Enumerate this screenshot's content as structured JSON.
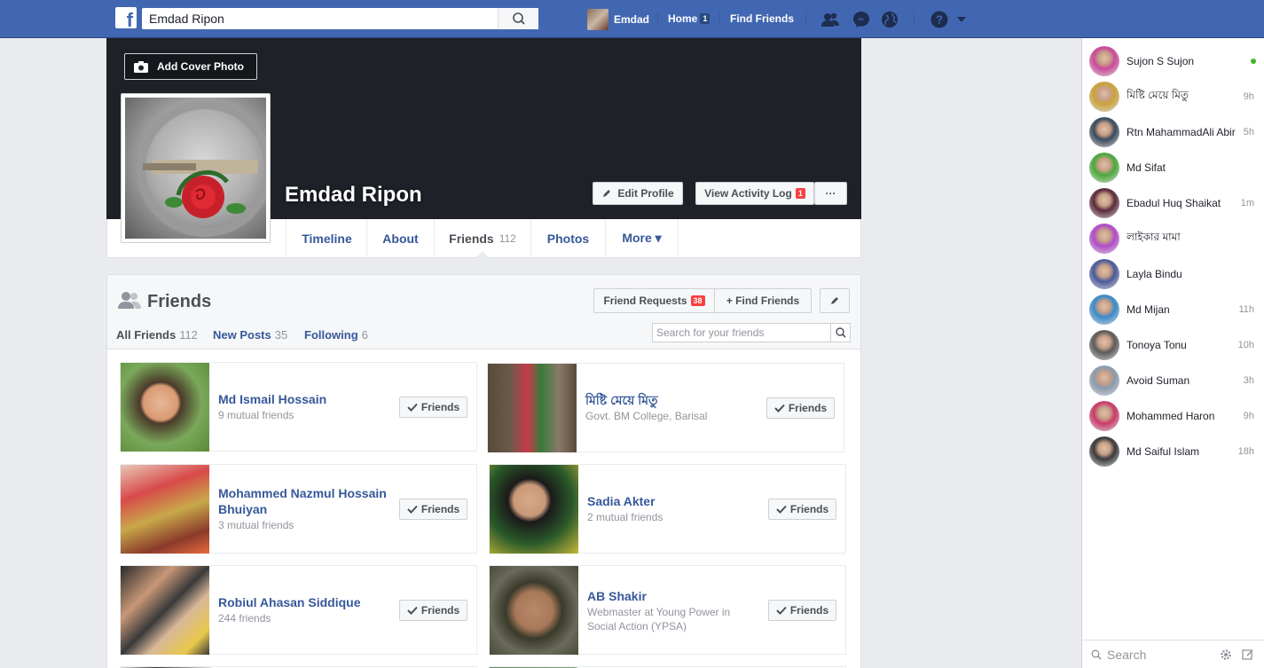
{
  "topbar": {
    "logo": "f",
    "search_value": "Emdad Ripon",
    "user_name": "Emdad",
    "home_label": "Home",
    "home_badge": "1",
    "find_friends_label": "Find Friends"
  },
  "cover": {
    "add_cover_label": "Add Cover Photo",
    "profile_name": "Emdad Ripon",
    "edit_profile_label": "Edit Profile",
    "activity_log_label": "View Activity Log",
    "activity_log_badge": "1",
    "more_label": "···"
  },
  "tabs": [
    {
      "label": "Timeline"
    },
    {
      "label": "About"
    },
    {
      "label": "Friends",
      "count": "112"
    },
    {
      "label": "Photos"
    },
    {
      "label": "More ▾"
    }
  ],
  "friends_panel": {
    "title": "Friends",
    "requests_label": "Friend Requests",
    "requests_badge": "38",
    "find_friends_label": "+ Find Friends",
    "subtabs": [
      {
        "label": "All Friends",
        "count": "112"
      },
      {
        "label": "New Posts",
        "count": "35"
      },
      {
        "label": "Following",
        "count": "6"
      }
    ],
    "search_placeholder": "Search for your friends",
    "button_label": "Friends",
    "friends": [
      {
        "name": "Md Ismail Hossain",
        "sub": "9 mutual friends",
        "photo": "#6b8f3a"
      },
      {
        "name": "মিষ্টি মেয়ে মিতু",
        "sub": "Govt. BM College, Barisal",
        "photo": "#9a3b3b"
      },
      {
        "name": "Mohammed Nazmul Hossain Bhuiyan",
        "sub": "3 mutual friends",
        "photo": "#b23a3a"
      },
      {
        "name": "Sadia Akter",
        "sub": "2 mutual friends",
        "photo": "#3b6b3a"
      },
      {
        "name": "Robiul Ahasan Siddique",
        "sub": "244 friends",
        "photo": "#4a3a2a"
      },
      {
        "name": "AB Shakir",
        "sub": "Webmaster at Young Power in Social Action (YPSA)",
        "photo": "#7a6a4a"
      }
    ]
  },
  "chat": {
    "search_placeholder": "Search",
    "contacts": [
      {
        "name": "Sujon S Sujon",
        "time": "",
        "online": true,
        "color": "#c94a9a"
      },
      {
        "name": "মিষ্টি মেয়ে মিতু",
        "time": "9h",
        "online": false,
        "color": "#c9a23a"
      },
      {
        "name": "Rtn MahammadAli Abir",
        "time": "5h",
        "online": false,
        "color": "#3a4a5a"
      },
      {
        "name": "Md Sifat",
        "time": "",
        "online": false,
        "color": "#4aa83a"
      },
      {
        "name": "Ebadul Huq Shaikat",
        "time": "1m",
        "online": false,
        "color": "#5a2a3a"
      },
      {
        "name": "লাইকার মামা",
        "time": "",
        "online": false,
        "color": "#b04ac9"
      },
      {
        "name": "Layla Bindu",
        "time": "",
        "online": false,
        "color": "#4a5a9a"
      },
      {
        "name": "Md Mijan",
        "time": "11h",
        "online": false,
        "color": "#3a8ac9"
      },
      {
        "name": "Tonoya Tonu",
        "time": "10h",
        "online": false,
        "color": "#5a5a5a"
      },
      {
        "name": "Avoid Suman",
        "time": "3h",
        "online": false,
        "color": "#8a9aaa"
      },
      {
        "name": "Mohammed Haron",
        "time": "9h",
        "online": false,
        "color": "#c93a6a"
      },
      {
        "name": "Md Saiful Islam",
        "time": "18h",
        "online": false,
        "color": "#3a3a3a"
      }
    ]
  }
}
